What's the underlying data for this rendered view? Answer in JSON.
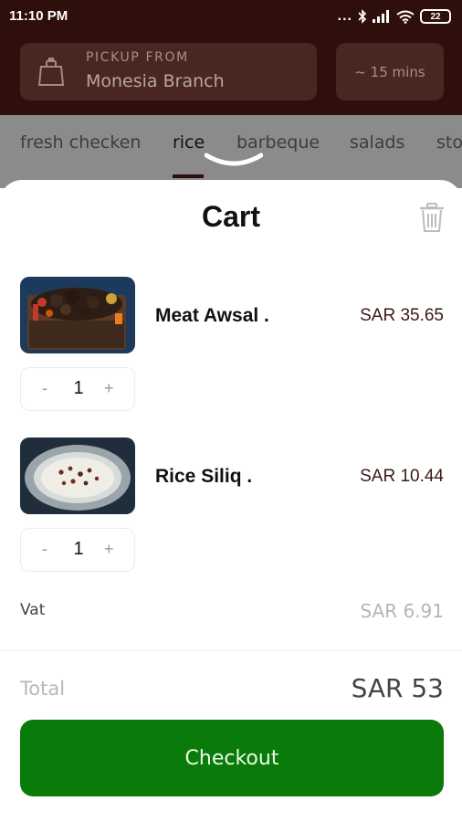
{
  "status_bar": {
    "time": "11:10 PM",
    "signal_dots": "...",
    "battery": "22"
  },
  "header": {
    "pickup_label": "PICKUP FROM",
    "branch": "Monesia Branch",
    "eta": "~ 15 mins"
  },
  "categories": [
    {
      "label": "fresh checken",
      "active": false
    },
    {
      "label": "rice",
      "active": true
    },
    {
      "label": "barbeque",
      "active": false
    },
    {
      "label": "salads",
      "active": false
    },
    {
      "label": "sto",
      "active": false
    }
  ],
  "cart": {
    "title": "Cart",
    "items": [
      {
        "name": "Meat Awsal .",
        "price": "SAR 35.65",
        "quantity": "1",
        "minus": "-",
        "plus": "+"
      },
      {
        "name": "Rice Siliq .",
        "price": "SAR 10.44",
        "quantity": "1",
        "minus": "-",
        "plus": "+"
      }
    ],
    "vat_label": "Vat",
    "vat_value": "SAR 6.91",
    "total_label": "Total",
    "total_value": "SAR 53",
    "checkout_label": "Checkout"
  },
  "colors": {
    "header_bg": "#2f0f0c",
    "header_card": "#4a2623",
    "tabs_overlay": "#8b8b8b",
    "checkout_green": "#0a7a0a",
    "price_text": "#3a1a16"
  }
}
